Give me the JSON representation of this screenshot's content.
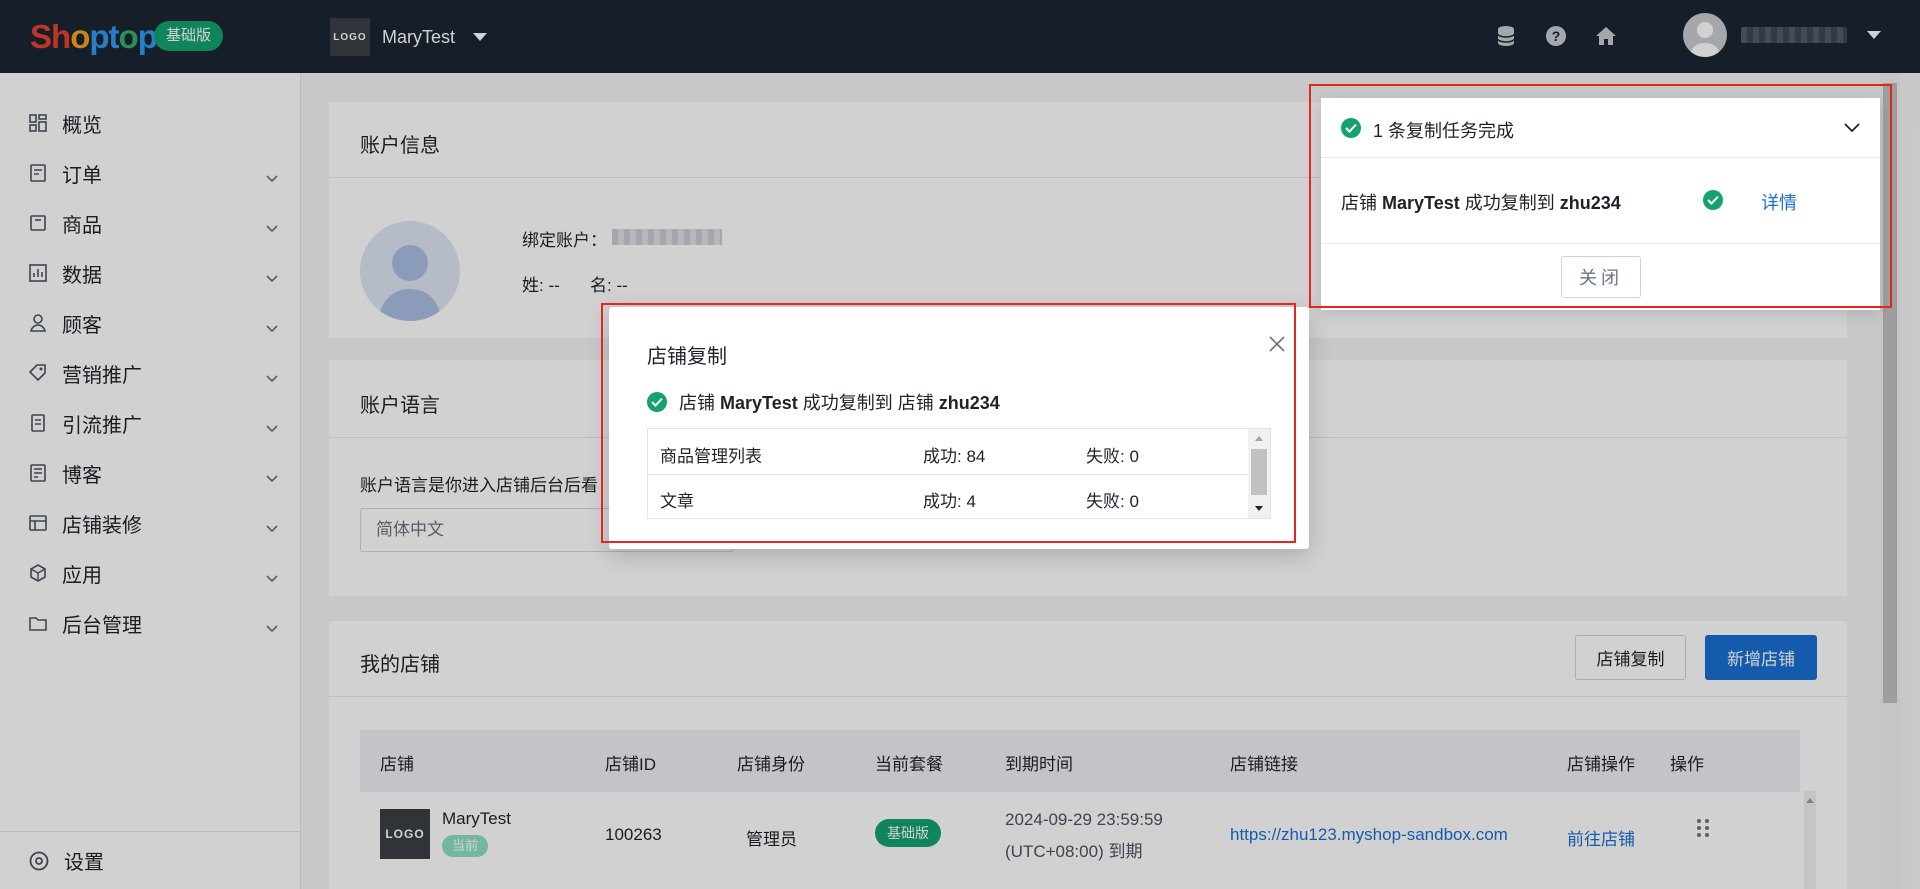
{
  "brand": {
    "logo_text": "Shoptop",
    "plan_badge": "基础版"
  },
  "store_switcher": {
    "logo_text": "LOGO",
    "name": "MaryTest"
  },
  "top_icons": [
    "database-icon",
    "help-icon",
    "home-icon"
  ],
  "sidebar": {
    "items": [
      {
        "label": "概览",
        "icon": "dashboard-icon",
        "expandable": false
      },
      {
        "label": "订单",
        "icon": "order-icon",
        "expandable": true
      },
      {
        "label": "商品",
        "icon": "product-icon",
        "expandable": true
      },
      {
        "label": "数据",
        "icon": "chart-icon",
        "expandable": true
      },
      {
        "label": "顾客",
        "icon": "user-icon",
        "expandable": true
      },
      {
        "label": "营销推广",
        "icon": "tag-icon",
        "expandable": true
      },
      {
        "label": "引流推广",
        "icon": "traffic-icon",
        "expandable": true
      },
      {
        "label": "博客",
        "icon": "blog-icon",
        "expandable": true
      },
      {
        "label": "店铺装修",
        "icon": "theme-icon",
        "expandable": true
      },
      {
        "label": "应用",
        "icon": "app-icon",
        "expandable": true
      },
      {
        "label": "后台管理",
        "icon": "folder-icon",
        "expandable": true
      }
    ],
    "settings_label": "设置"
  },
  "account_info": {
    "title": "账户信息",
    "bound_account_label": "绑定账户：",
    "last_name_label": "姓: --",
    "first_name_label": "名: --"
  },
  "account_language": {
    "title": "账户语言",
    "description": "账户语言是你进入店铺后台后看",
    "selected": "简体中文"
  },
  "my_stores": {
    "title": "我的店铺",
    "copy_button": "店铺复制",
    "add_button": "新增店铺",
    "columns": [
      "店铺",
      "店铺ID",
      "店铺身份",
      "当前套餐",
      "到期时间",
      "店铺链接",
      "店铺操作",
      "操作"
    ],
    "rows": [
      {
        "logo_text": "LOGO",
        "name": "MaryTest",
        "current_tag": "当前",
        "id": "100263",
        "role": "管理员",
        "plan": "基础版",
        "expire_line1": "2024-09-29 23:59:59",
        "expire_line2": "(UTC+08:00) 到期",
        "link": "https://zhu123.myshop-sandbox.com",
        "action": "前往店铺"
      }
    ]
  },
  "notification": {
    "header": "1 条复制任务完成",
    "message_pre": "店铺 ",
    "message_store": "MaryTest",
    "message_mid": " 成功复制到 ",
    "message_target": "zhu234",
    "detail_link": "详情",
    "close_button": "关闭"
  },
  "dialog": {
    "title": "店铺复制",
    "message_pre": "店铺 ",
    "message_store": "MaryTest",
    "message_mid": " 成功复制到 店铺 ",
    "message_target": "zhu234",
    "rows": [
      {
        "name": "商品管理列表",
        "success": "成功: 84",
        "fail": "失败: 0"
      },
      {
        "name": "文章",
        "success": "成功: 4",
        "fail": "失败: 0"
      }
    ]
  },
  "colors": {
    "accent": "#1a6fd4",
    "success": "#14a36f",
    "topbar": "#1c2533",
    "highlight": "#e5261f"
  }
}
